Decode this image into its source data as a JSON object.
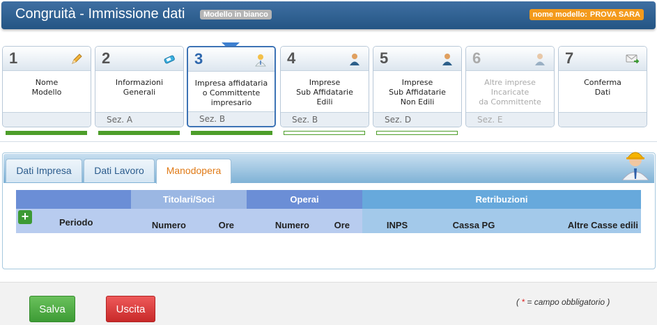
{
  "header": {
    "title": "Congruità - Immissione dati",
    "mode_badge": "Modello in bianco",
    "model_label": "nome modello:",
    "model_name": "PROVA SARA"
  },
  "steps": [
    {
      "num": "1",
      "label": "Nome\nModello",
      "section": "",
      "icon": "pencil-icon",
      "state": "done"
    },
    {
      "num": "2",
      "label": "Informazioni\nGenerali",
      "section": "Sez. A",
      "icon": "eraser-icon",
      "state": "done"
    },
    {
      "num": "3",
      "label": "Impresa affidataria\no Committente\nimpresario",
      "section": "Sez. B",
      "icon": "person-icon",
      "state": "active"
    },
    {
      "num": "4",
      "label": "Imprese\nSub Affidatarie\nEdili",
      "section": "Sez. B",
      "icon": "person-icon",
      "state": "todo"
    },
    {
      "num": "5",
      "label": "Imprese\nSub Affidatarie\nNon Edili",
      "section": "Sez. D",
      "icon": "person-icon",
      "state": "todo"
    },
    {
      "num": "6",
      "label": "Altre imprese\nIncaricate\nda Committente",
      "section": "Sez. E",
      "icon": "person-icon",
      "state": "disabled"
    },
    {
      "num": "7",
      "label": "Conferma\nDati",
      "section": "",
      "icon": "mail-forward-icon",
      "state": "plain"
    }
  ],
  "tabs": [
    {
      "label": "Dati Impresa",
      "active": false
    },
    {
      "label": "Dati Lavoro",
      "active": false
    },
    {
      "label": "Manodopera",
      "active": true
    }
  ],
  "grid": {
    "group_headers": {
      "titolari": "Titolari/Soci",
      "operai": "Operai",
      "retribuzioni": "Retribuzioni"
    },
    "columns": {
      "periodo": "Periodo",
      "tit_numero": "Numero",
      "tit_ore": "Ore",
      "op_numero": "Numero",
      "op_ore": "Ore",
      "inps": "INPS",
      "cassa_pg": "Cassa PG",
      "altre_casse": "Altre Casse edili"
    },
    "add_symbol": "+"
  },
  "footer": {
    "save": "Salva",
    "exit": "Uscita",
    "note_prefix": "(",
    "note_star": "*",
    "note_text": "= campo obbligatorio )"
  },
  "colors": {
    "header_bg": "#245584",
    "accent_orange": "#f39a1c",
    "progress_green": "#4d9e2a",
    "save_green": "#3d9b35",
    "exit_red": "#c82929"
  }
}
